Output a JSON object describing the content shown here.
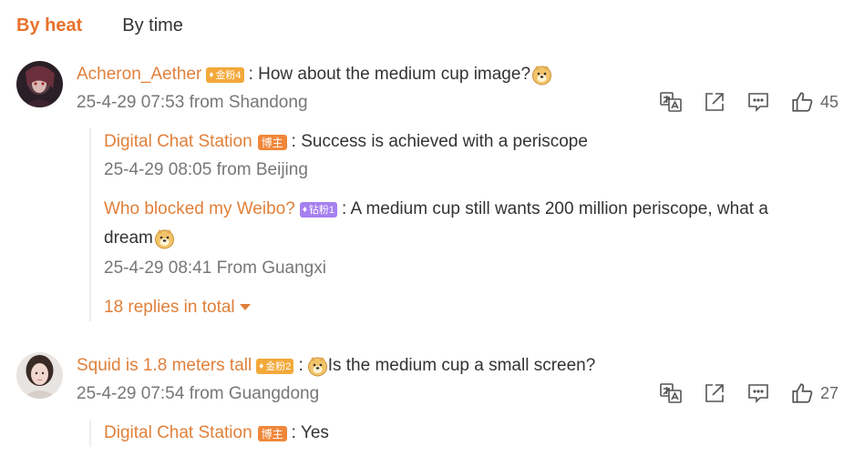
{
  "tabs": [
    {
      "label": "By heat",
      "active": true
    },
    {
      "label": "By time",
      "active": false
    }
  ],
  "comments": [
    {
      "user": "Acheron_Aether",
      "badge": "金粉4",
      "text": ": How about the medium cup image?",
      "meta": "25-4-29 07:53 from Shandong",
      "likes": "45",
      "replies": [
        {
          "user": "Digital Chat Station",
          "badge": "博主",
          "text": ": Success is achieved with a periscope",
          "meta": "25-4-29 08:05 from Beijing"
        },
        {
          "user": "Who blocked my Weibo?",
          "badge": "钻粉1",
          "text": ": A medium cup still wants 200 million periscope, what a",
          "text2": "dream",
          "meta": "25-4-29 08:41 From Guangxi"
        }
      ],
      "more": "18 replies in total"
    },
    {
      "user": "Squid is 1.8 meters tall",
      "badge": "金粉2",
      "text_prefix": ":",
      "text": "Is the medium cup a small screen?",
      "meta": "25-4-29 07:54 from Guangdong",
      "likes": "27",
      "replies": [
        {
          "user": "Digital Chat Station",
          "badge": "博主",
          "text": ": Yes"
        }
      ]
    }
  ],
  "colors": {
    "accent": "#e8722c",
    "username": "#e0803a",
    "gold_badge": "#f3a93a",
    "diamond_badge": "#a680f0"
  },
  "icons": [
    "translate-icon",
    "share-icon",
    "comment-icon",
    "like-icon",
    "doge-emoji",
    "chevron-down-icon"
  ]
}
